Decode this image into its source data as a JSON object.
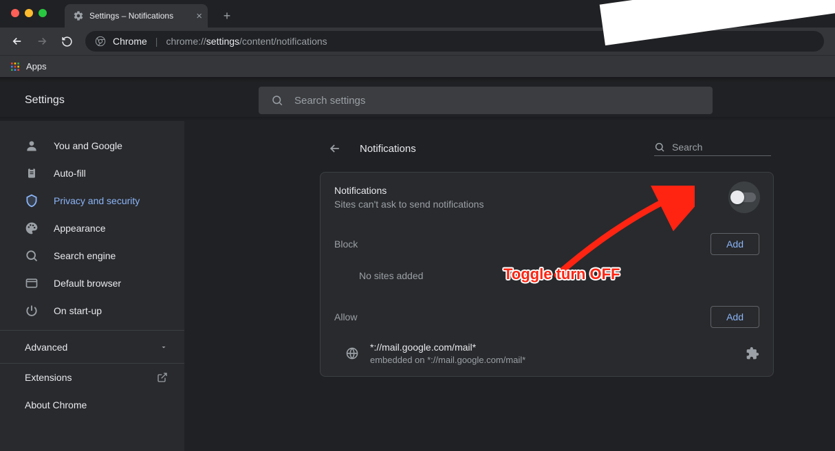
{
  "tab": {
    "title": "Settings – Notifications"
  },
  "address": {
    "scheme_label": "Chrome",
    "url_prefix": "chrome://",
    "url_bold": "settings",
    "url_rest": "/content/notifications"
  },
  "bookmarks": {
    "apps": "Apps"
  },
  "settings_title": "Settings",
  "search_placeholder": "Search settings",
  "sidebar": {
    "items": [
      {
        "label": "You and Google"
      },
      {
        "label": "Auto-fill"
      },
      {
        "label": "Privacy and security"
      },
      {
        "label": "Appearance"
      },
      {
        "label": "Search engine"
      },
      {
        "label": "Default browser"
      },
      {
        "label": "On start-up"
      }
    ],
    "advanced": "Advanced",
    "extensions": "Extensions",
    "about": "About Chrome"
  },
  "panel": {
    "title": "Notifications",
    "search": "Search",
    "notif_title": "Notifications",
    "notif_sub": "Sites can't ask to send notifications",
    "block_label": "Block",
    "add_label": "Add",
    "block_empty": "No sites added",
    "allow_label": "Allow",
    "allow_item": {
      "pattern": "*://mail.google.com/mail*",
      "embedded": "embedded on *://mail.google.com/mail*"
    }
  },
  "annotation": "Toggle turn OFF"
}
